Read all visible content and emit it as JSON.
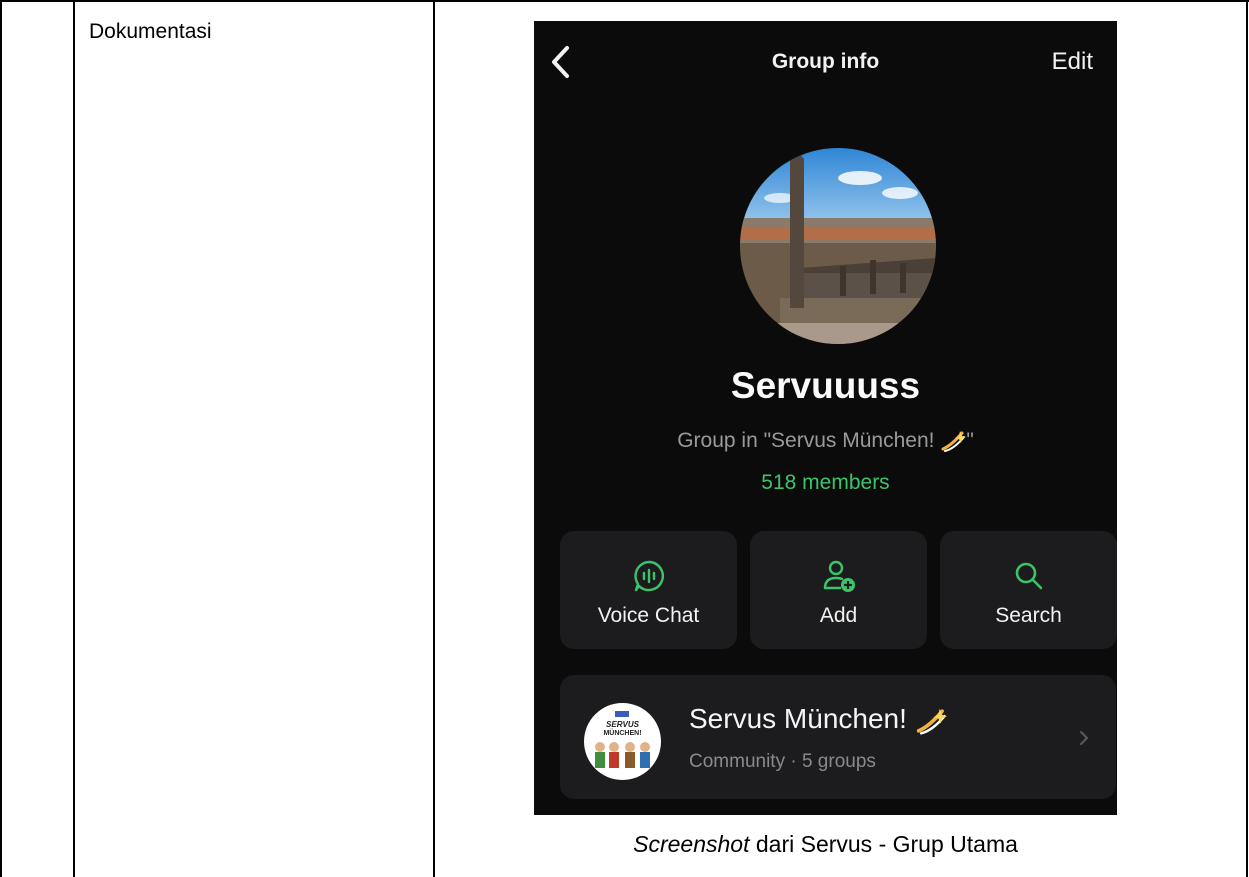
{
  "table": {
    "label": "Dokumentasi"
  },
  "screen": {
    "nav": {
      "title": "Group info",
      "edit": "Edit",
      "back_icon": "chevron-left-icon"
    },
    "group": {
      "name": "Servuuuss",
      "subtitle": "Group in \"Servus München! ",
      "subtitle_end": "\"",
      "members": "518 members"
    },
    "actions": [
      {
        "label": "Voice Chat",
        "icon": "voice-chat-icon"
      },
      {
        "label": "Add",
        "icon": "add-person-icon"
      },
      {
        "label": "Search",
        "icon": "search-icon"
      }
    ],
    "community": {
      "title": "Servus München! ",
      "subtitle": "Community · 5 groups",
      "avatar_text": [
        "SERVUS",
        "MÜNCHEN!"
      ]
    },
    "colors": {
      "accent": "#3cc46b",
      "background": "#0b0b0b",
      "card": "#1c1c1e"
    }
  },
  "caption": {
    "italic": "Screenshot",
    "rest": " dari Servus - Grup Utama"
  }
}
